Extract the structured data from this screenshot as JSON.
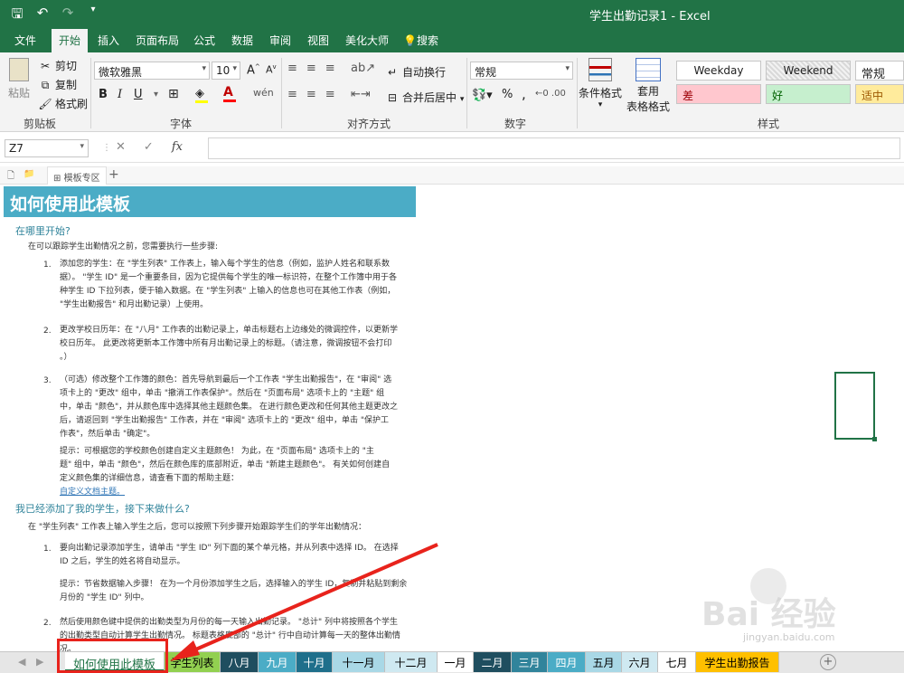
{
  "titlebar": {
    "title": "学生出勤记录1 - Excel"
  },
  "qat": {
    "save_icon": "save-icon",
    "undo_icon": "undo-icon",
    "redo_icon": "redo-icon",
    "customize_icon": "customize-qat-icon"
  },
  "ribbon_tabs": [
    {
      "label": "文件"
    },
    {
      "label": "开始"
    },
    {
      "label": "插入"
    },
    {
      "label": "页面布局"
    },
    {
      "label": "公式"
    },
    {
      "label": "数据"
    },
    {
      "label": "审阅"
    },
    {
      "label": "视图"
    },
    {
      "label": "美化大师"
    },
    {
      "label": "搜索"
    }
  ],
  "ribbon": {
    "clipboard": {
      "paste": "粘贴",
      "cut": "剪切",
      "copy": "复制",
      "format_painter": "格式刷",
      "group": "剪贴板"
    },
    "font": {
      "name": "微软雅黑",
      "size": "10",
      "group": "字体",
      "bold": "B",
      "italic": "I",
      "underline": "U"
    },
    "alignment": {
      "wrap": "自动换行",
      "merge": "合并后居中",
      "group": "对齐方式"
    },
    "number": {
      "format": "常规",
      "group": "数字",
      "percent": "%",
      "comma": ","
    },
    "styles": {
      "conditional": "条件格式",
      "table_line1": "套用",
      "table_line2": "表格格式",
      "group": "样式",
      "cells": [
        "Weekday",
        "Weekend",
        "常规",
        "差",
        "好",
        "适中"
      ]
    },
    "colors": {
      "accent": "#217346",
      "bad_bg": "#ffc7ce",
      "good_bg": "#c6efce",
      "neutral_bg": "#ffeb9c"
    }
  },
  "formula_bar": {
    "name_box": "Z7",
    "fx": "fx",
    "cancel": "✕",
    "enter": "✓"
  },
  "workbook_tabs": {
    "label": "模板专区",
    "add": "+"
  },
  "sheet": {
    "header": "如何使用此模板",
    "sec1": "在哪里开始?",
    "intro1": "在可以跟踪学生出勤情况之前，您需要执行一些步骤:",
    "n1": "1.",
    "s1_1": "添加您的学生：在 \"学生列表\" 工作表上，输入每个学生的信息（例如，监护人姓名和联系数",
    "s1_2": "据）。 \"学生 ID\" 是一个重要条目，因为它提供每个学生的唯一标识符，在整个工作簿中用于各",
    "s1_3": "种学生 ID 下拉列表，便于输入数据。在 \"学生列表\" 上输入的信息也可在其他工作表（例如，",
    "s1_4": "\"学生出勤报告\" 和月出勤记录）上使用。",
    "n2": "2.",
    "s2_1": "更改学校日历年：在 \"八月\" 工作表的出勤记录上，单击标题右上边缘处的微调控件，以更新学",
    "s2_2": "校日历年。 此更改将更新本工作簿中所有月出勤记录上的标题。（请注意，微调按钮不会打印",
    "s2_3": "。）",
    "n3": "3.",
    "s3_1": "（可选）修改整个工作簿的颜色：首先导航到最后一个工作表 \"学生出勤报告\"，在 \"审阅\" 选",
    "s3_2": "项卡上的 \"更改\" 组中，单击 \"撤消工作表保护\"。然后在 \"页面布局\" 选项卡上的 \"主题\" 组",
    "s3_3": "中，单击 \"颜色\"，并从颜色库中选择其他主题颜色集。 在进行颜色更改和任何其他主题更改之",
    "s3_4": "后，请返回到 \"学生出勤报告\" 工作表，并在 \"审阅\" 选项卡上的 \"更改\" 组中，单击 \"保护工",
    "s3_5": "作表\"，然后单击 \"确定\"。",
    "tip1_1": "提示：可根据您的学校颜色创建自定义主题颜色！ 为此，在 \"页面布局\" 选项卡上的 \"主",
    "tip1_2": "题\" 组中，单击 \"颜色\"，然后在颜色库的底部附近，单击 \"新建主题颜色\"。 有关如何创建自",
    "tip1_3": "定义颜色集的详细信息，请查看下面的帮助主题：",
    "tip1_link": "自定义文档主题。",
    "sec2": "我已经添加了我的学生，接下来做什么?",
    "intro2": "在 \"学生列表\" 工作表上输入学生之后，您可以按照下列步骤开始跟踪学生们的学年出勤情况：",
    "m1": "1.",
    "t1_1": "要向出勤记录添加学生，请单击 \"学生 ID\" 列下面的某个单元格，并从列表中选择 ID。 在选择",
    "t1_2": "ID 之后，学生的姓名将自动显示。",
    "tip2_1": "提示：节省数据输入步骤！ 在为一个月份添加学生之后，选择输入的学生 ID，复制并粘贴到剩余",
    "tip2_2": "月份的 \"学生 ID\" 列中。",
    "m2": "2.",
    "t2_1": "然后使用颜色键中提供的出勤类型为月份的每一天输入出勤记录。 \"总计\" 列中将按照各个学生",
    "t2_2": "的出勤类型自动计算学生出勤情况。 标题表格底部的 \"总计\" 行中自动计算每一天的整体出勤情",
    "t2_3": "况。"
  },
  "sheet_tabs": [
    {
      "label": "如何使用此模板",
      "bg": "#ffffff",
      "fg": "#217346"
    },
    {
      "label": "学生列表",
      "bg": "#92d050",
      "fg": "#000000"
    },
    {
      "label": "八月",
      "bg": "#1f4e5f",
      "fg": "#ffffff"
    },
    {
      "label": "九月",
      "bg": "#4bacc6",
      "fg": "#ffffff"
    },
    {
      "label": "十月",
      "bg": "#1f6f8b",
      "fg": "#ffffff"
    },
    {
      "label": "十一月",
      "bg": "#a9d8e6",
      "fg": "#000000"
    },
    {
      "label": "十二月",
      "bg": "#cfe9f1",
      "fg": "#000000"
    },
    {
      "label": "一月",
      "bg": "#ffffff",
      "fg": "#000000"
    },
    {
      "label": "二月",
      "bg": "#1f4e5f",
      "fg": "#ffffff"
    },
    {
      "label": "三月",
      "bg": "#31849b",
      "fg": "#ffffff"
    },
    {
      "label": "四月",
      "bg": "#4bacc6",
      "fg": "#ffffff"
    },
    {
      "label": "五月",
      "bg": "#a9d8e6",
      "fg": "#000000"
    },
    {
      "label": "六月",
      "bg": "#cfe9f1",
      "fg": "#000000"
    },
    {
      "label": "七月",
      "bg": "#ffffff",
      "fg": "#000000"
    },
    {
      "label": "学生出勤报告",
      "bg": "#ffc000",
      "fg": "#000000"
    }
  ],
  "watermark": {
    "text": "Bai 经验",
    "sub": "jingyan.baidu.com"
  }
}
